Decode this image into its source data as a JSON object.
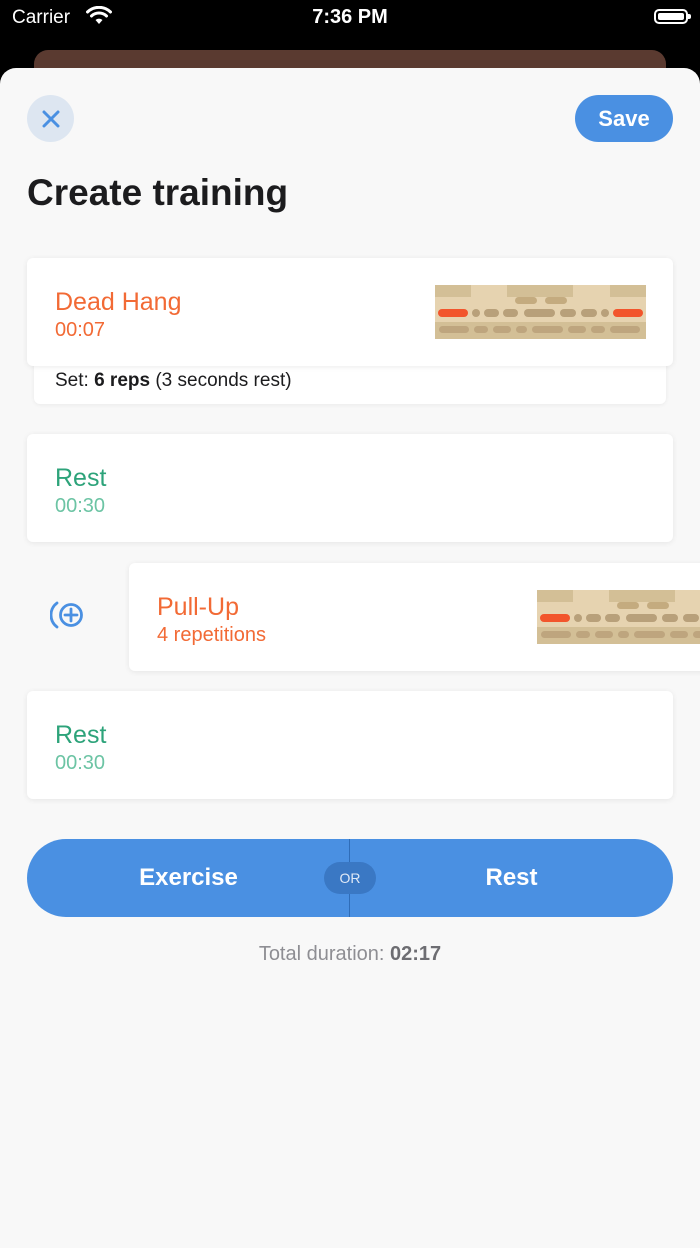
{
  "status_bar": {
    "carrier": "Carrier",
    "time": "7:36 PM"
  },
  "header": {
    "title": "Create training",
    "save_label": "Save"
  },
  "items": [
    {
      "kind": "exercise",
      "name": "Dead Hang",
      "detail": "00:07"
    },
    {
      "kind": "rest",
      "name": "Rest",
      "detail": "00:30"
    },
    {
      "kind": "exercise",
      "name": "Pull-Up",
      "detail": "4 repetitions"
    },
    {
      "kind": "rest",
      "name": "Rest",
      "detail": "00:30"
    }
  ],
  "set_info": {
    "prefix": "Set: ",
    "reps": "6 reps",
    "suffix": " (3 seconds rest)"
  },
  "add_buttons": {
    "exercise": "Exercise",
    "or": "OR",
    "rest": "Rest"
  },
  "total": {
    "label": "Total duration: ",
    "value": "02:17"
  },
  "colors": {
    "accent": "#4a90e2",
    "exercise": "#f26a35",
    "rest": "#2da37a",
    "board_hold_active": "#f2552c"
  },
  "icons": {
    "close": "close-icon",
    "wifi": "wifi-icon",
    "battery": "battery-icon",
    "add": "add-circle-icon",
    "board": "hangboard-icon"
  }
}
